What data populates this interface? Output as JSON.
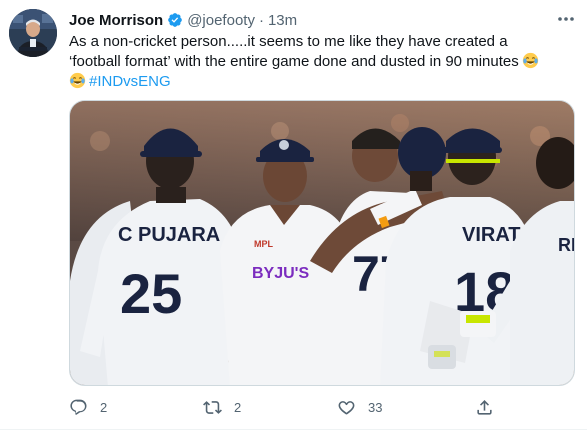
{
  "tweet": {
    "author_name": "Joe Morrison",
    "handle": "@joefooty",
    "separator": "·",
    "time": "13m",
    "text_line1": "As a non-cricket person.....it seems to me like they have created a",
    "text_line2": "‘football format’ with the entire game done and dusted in 90 minutes",
    "hashtag": "#INDvsENG",
    "image_text": {
      "left_player": "C PUJARA",
      "left_number": "25",
      "sponsor": "BYJU'S",
      "kit_brand": "MPL",
      "center_number": "77",
      "right_player": "VIRAT",
      "right_number": "18",
      "far_right_player": "RIS"
    },
    "counts": {
      "replies": "2",
      "retweets": "2",
      "likes": "33"
    }
  },
  "icons": {
    "verified": "verified-badge-icon",
    "more": "more-options-icon",
    "emoji": "laughing-tears-emoji-icon",
    "reply": "reply-icon",
    "retweet": "retweet-icon",
    "like": "heart-icon",
    "share": "share-icon"
  },
  "colors": {
    "accent": "#1d9bf0",
    "text": "#0f1419",
    "secondary": "#536471",
    "cricket_whites": "#f1f3f6",
    "caps": "#1a2340"
  }
}
